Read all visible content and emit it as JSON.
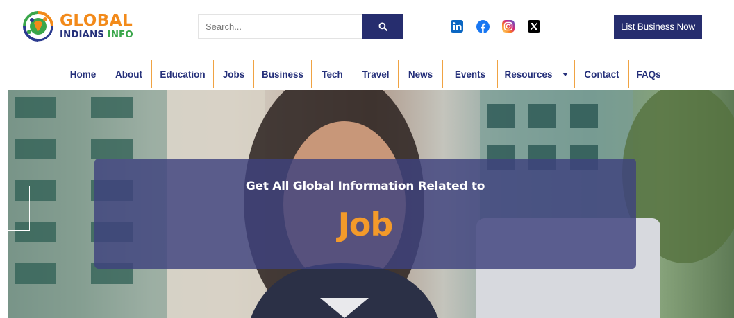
{
  "header": {
    "logo": {
      "line1": "GLOBAL",
      "line2a": "INDIANS",
      "line2b": "INFO"
    },
    "search": {
      "placeholder": "Search...",
      "icon": "search-icon"
    },
    "socials": [
      {
        "name": "linkedin-icon",
        "color": "#0a66c2"
      },
      {
        "name": "facebook-icon",
        "color": "#1877f2"
      },
      {
        "name": "instagram-icon",
        "color": "#e1306c"
      },
      {
        "name": "x-twitter-icon",
        "color": "#000000"
      }
    ],
    "cta_label": "List Business Now"
  },
  "nav": {
    "items": [
      {
        "label": "Home"
      },
      {
        "label": "About"
      },
      {
        "label": "Education"
      },
      {
        "label": "Jobs"
      },
      {
        "label": "Business"
      },
      {
        "label": "Tech"
      },
      {
        "label": "Travel"
      },
      {
        "label": "News"
      },
      {
        "label": "Events"
      },
      {
        "label": "Resources",
        "dropdown": true
      },
      {
        "label": "Contact"
      },
      {
        "label": "FAQs"
      }
    ]
  },
  "hero": {
    "subtitle": "Get All Global Information Related to",
    "highlight": "Job"
  },
  "colors": {
    "primary": "#262d6e",
    "accent": "#f39a2a",
    "overlay": "#3e427e",
    "nav_divider": "#f0a343"
  }
}
